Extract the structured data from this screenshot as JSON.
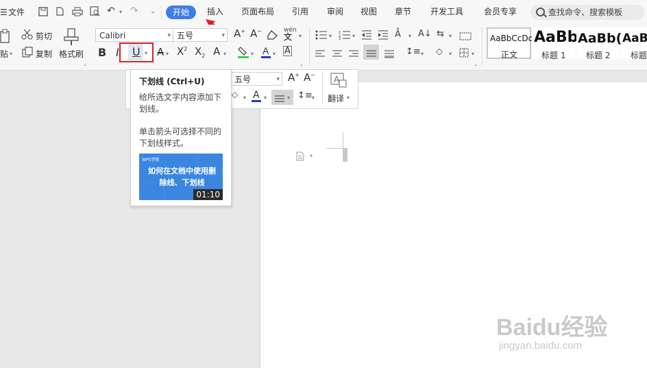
{
  "window": {
    "file_menu": "文件",
    "tabs": [
      "开始",
      "插入",
      "页面布局",
      "引用",
      "审阅",
      "视图",
      "章节",
      "开发工具",
      "会员专享"
    ],
    "active_tab": "开始",
    "search_placeholder": "查找命令、搜索模板"
  },
  "ribbon": {
    "clipboard": {
      "paste": "贴",
      "cut": "剪切",
      "copy": "复制",
      "format_painter": "格式刷"
    },
    "font": {
      "name": "Calibri",
      "size": "五号",
      "phonetic": "wén"
    },
    "styles": [
      {
        "preview": "AaBbCcDd",
        "name": "正文"
      },
      {
        "preview": "AaBb",
        "name": "标题 1"
      },
      {
        "preview": "AaBb(",
        "name": "标题 2"
      },
      {
        "preview": "AaB",
        "name": "标题"
      }
    ],
    "highlight_color": "#3f7ee8",
    "underline_highlight_color": "#e02020"
  },
  "mini_toolbar": {
    "size": "五号",
    "translate": "翻译"
  },
  "tooltip": {
    "title": "下划线 (Ctrl+U)",
    "desc1": "给所选文字内容添加下划线。",
    "desc2": "单击箭头可选择不同的下划线样式。",
    "video_title": "如何在文档中使用删除线、下划线",
    "video_duration": "01:10",
    "video_logo": "WPS学院"
  },
  "watermark": {
    "brand": "Baidu经验",
    "url": "jingyan.baidu.com"
  }
}
